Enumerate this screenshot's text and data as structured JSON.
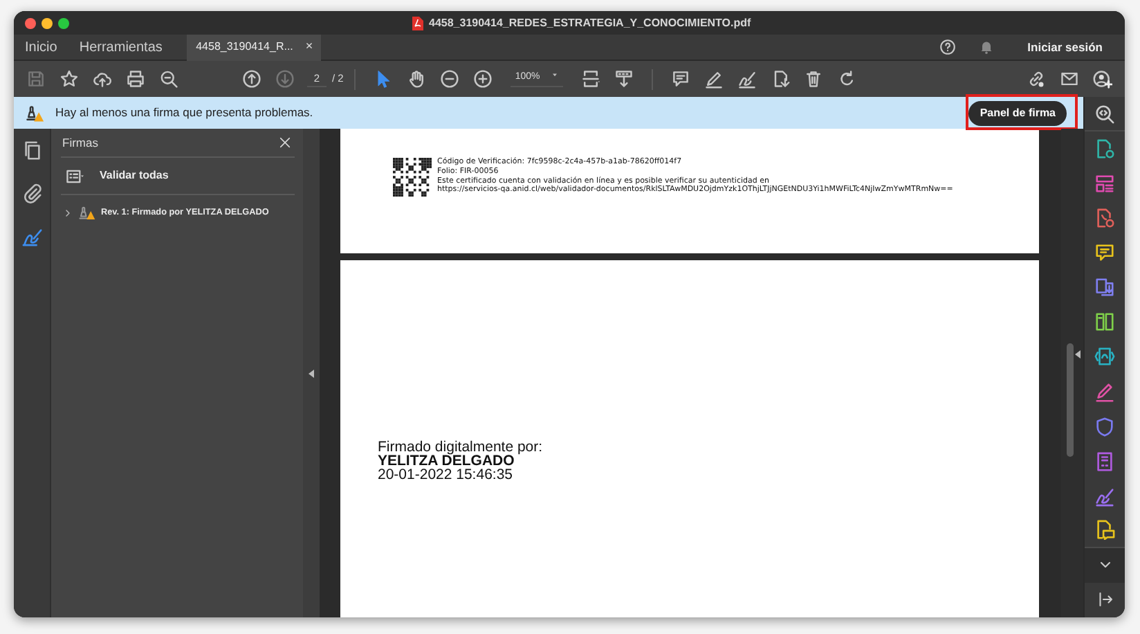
{
  "window": {
    "title": "4458_3190414_REDES_ESTRATEGIA_Y_CONOCIMIENTO.pdf"
  },
  "tabs": [
    {
      "label": "Inicio",
      "selected": false
    },
    {
      "label": "Herramientas",
      "selected": false
    },
    {
      "label": "4458_3190414_R...",
      "selected": true,
      "close": "×"
    }
  ],
  "header": {
    "signin": "Iniciar sesión"
  },
  "toolbar": {
    "page_current": "2",
    "page_total": "/ 2",
    "zoom": "100%"
  },
  "notification": {
    "message": "Hay al menos una firma que presenta problemas.",
    "button": "Panel de firma",
    "highlighted": true
  },
  "left_rail": [
    {
      "kind": "pages",
      "selected": false
    },
    {
      "kind": "attachments",
      "selected": false
    },
    {
      "kind": "signatures",
      "selected": true
    }
  ],
  "signatures_panel": {
    "title": "Firmas",
    "validate_all": "Validar todas",
    "items": [
      {
        "label": "Rev. 1: Firmado por YELITZA DELGADO",
        "expanded": false,
        "warning": true
      }
    ]
  },
  "document": {
    "verification_lines": [
      "Código de Verificación: 7fc9598c-2c4a-457b-a1ab-78620ff014f7",
      "Folio: FIR-00056",
      "Este certificado cuenta con validación en línea y es posible verificar su autenticidad en",
      "https://servicios-qa.anid.cl/web/validador-documentos/RklSLTAwMDU2OjdmYzk1OThjLTJjNGEtNDU3Yi1hMWFiLTc4NjIwZmYwMTRmNw=="
    ],
    "signature_lines": [
      {
        "kind": "plain",
        "text": "Firmado digitalmente por:"
      },
      {
        "kind": "name",
        "text": "YELITZA DELGADO"
      },
      {
        "kind": "plain",
        "text": "20-01-2022 15:46:35"
      }
    ]
  }
}
